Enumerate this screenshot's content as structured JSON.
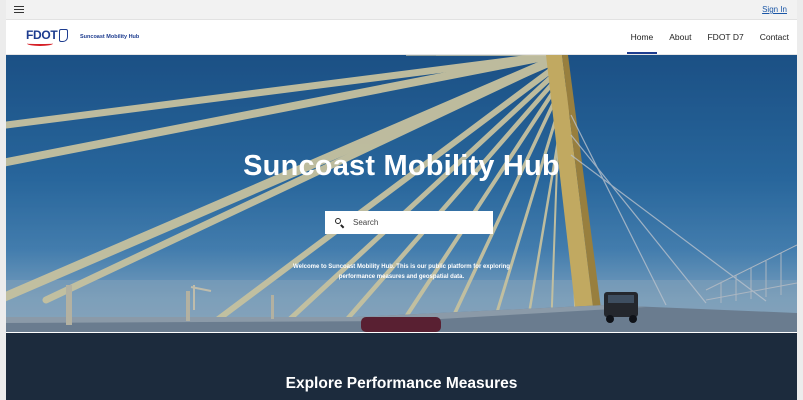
{
  "topbar": {
    "menu_icon": "hamburger-menu-icon",
    "sign_in": "Sign In"
  },
  "header": {
    "logo_text": "FDOT",
    "brand_name": "Suncoast Mobility Hub",
    "nav": [
      {
        "label": "Home",
        "active": true
      },
      {
        "label": "About",
        "active": false
      },
      {
        "label": "FDOT D7",
        "active": false
      },
      {
        "label": "Contact",
        "active": false
      }
    ]
  },
  "hero": {
    "title": "Suncoast Mobility Hub",
    "search_placeholder": "Search",
    "welcome_line1": "Welcome to Suncoast Mobility Hub. This is our public platform for exploring",
    "welcome_line2": "performance measures and geospatial data.",
    "background": "suspension bridge cables over blue sky"
  },
  "explore": {
    "title": "Explore Performance Measures"
  },
  "colors": {
    "brand_blue": "#1d3c8f",
    "brand_red": "#d62027",
    "link_blue": "#1a56a6",
    "dark_section": "#1c2b3d"
  }
}
